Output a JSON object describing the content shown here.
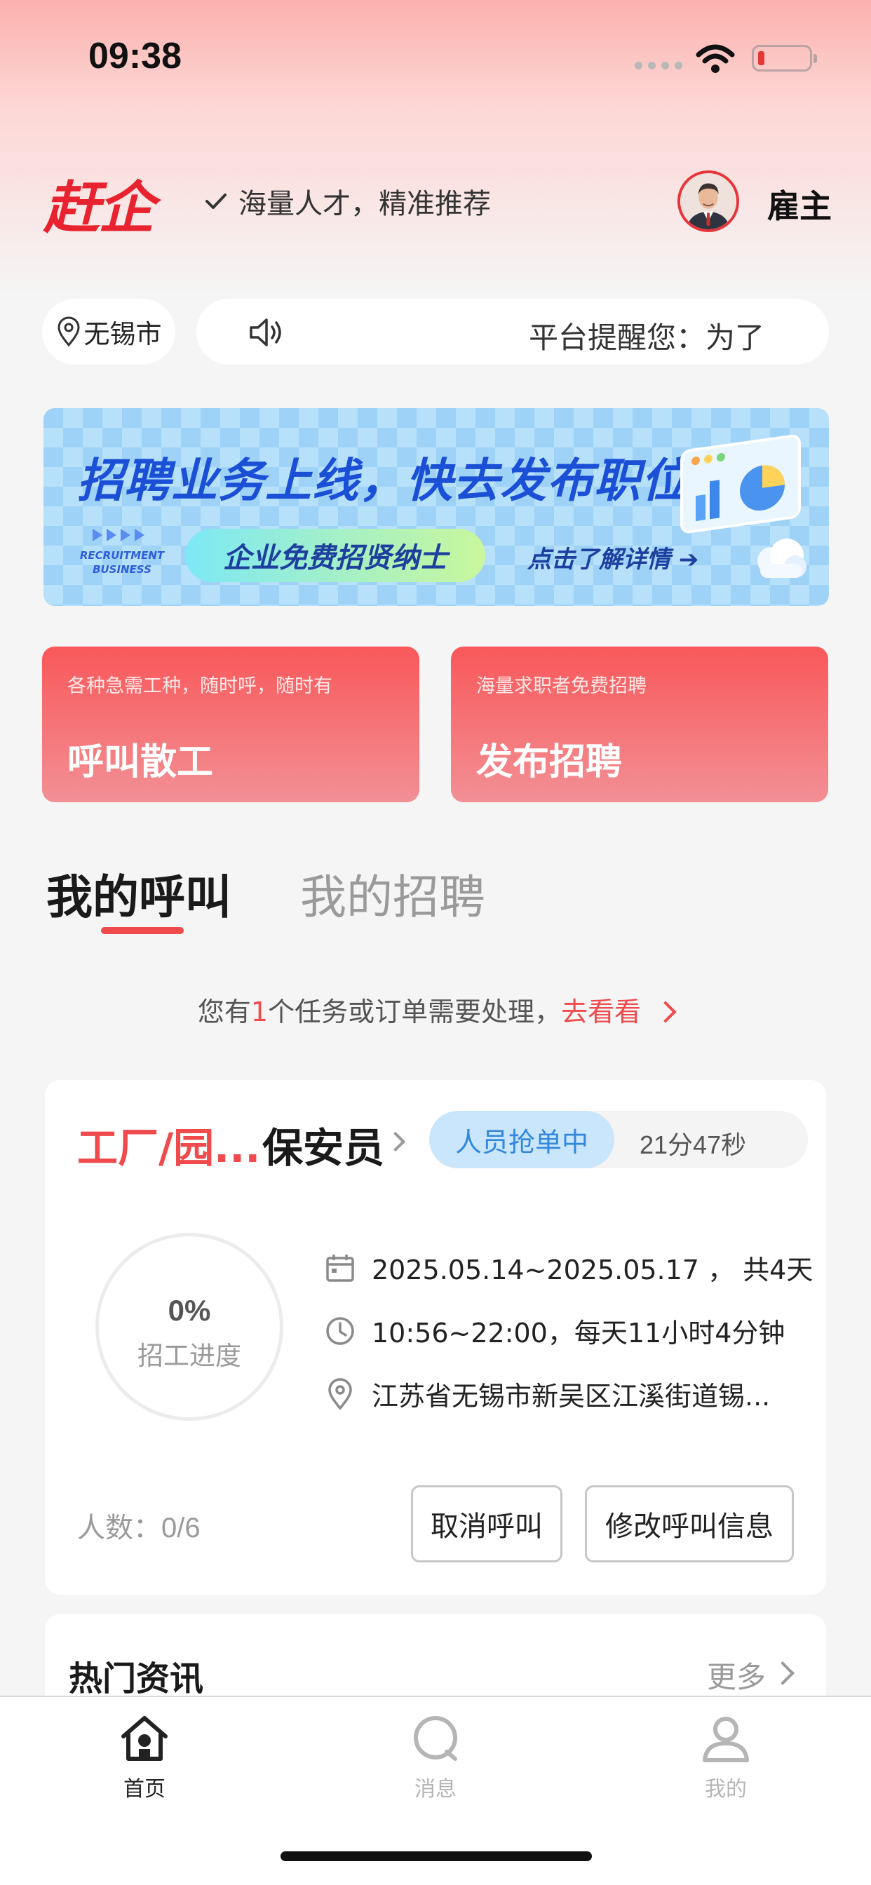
{
  "status_bar": {
    "time": "09:38"
  },
  "header": {
    "logo": "赶企",
    "slogan": "海量人才，精准推荐",
    "role": "雇主"
  },
  "location": {
    "city": "无锡市"
  },
  "notice": {
    "text": "平台提醒您：为了"
  },
  "banner": {
    "headline": "招聘业务上线，快去发布职位！",
    "chip": "企业免费招贤纳士",
    "detail": "点击了解详情 ➔",
    "english_line1": "RECRUITMENT",
    "english_line2": "BUSINESS"
  },
  "actions": [
    {
      "subtitle": "各种急需工种，随时呼，随时有",
      "title": "呼叫散工"
    },
    {
      "subtitle": "海量求职者免费招聘",
      "title": "发布招聘"
    }
  ],
  "tabs": [
    {
      "label": "我的呼叫",
      "active": true
    },
    {
      "label": "我的招聘",
      "active": false
    }
  ],
  "task_tip": {
    "prefix": "您有",
    "count": "1",
    "suffix": "个任务或订单需要处理，",
    "link": "去看看"
  },
  "order": {
    "place": "工厂/园...",
    "job": "保安员",
    "status": "人员抢单中",
    "timer": "21分47秒",
    "progress_percent": "0%",
    "progress_label": "招工进度",
    "date_range": "2025.05.14~2025.05.17 ， 共4天",
    "time_range": "10:56~22:00，每天11小时4分钟",
    "address": "江苏省无锡市新吴区江溪街道锡...",
    "headcount": "人数：0/6",
    "cancel_label": "取消呼叫",
    "edit_label": "修改呼叫信息"
  },
  "news": {
    "title": "热门资讯",
    "more": "更多"
  },
  "tabbar": [
    {
      "label": "首页",
      "active": true,
      "icon": "home-icon"
    },
    {
      "label": "消息",
      "active": false,
      "icon": "message-icon"
    },
    {
      "label": "我的",
      "active": false,
      "icon": "user-icon"
    }
  ],
  "colors": {
    "accent": "#ef4a4c",
    "status_blue": "#3387dd"
  }
}
